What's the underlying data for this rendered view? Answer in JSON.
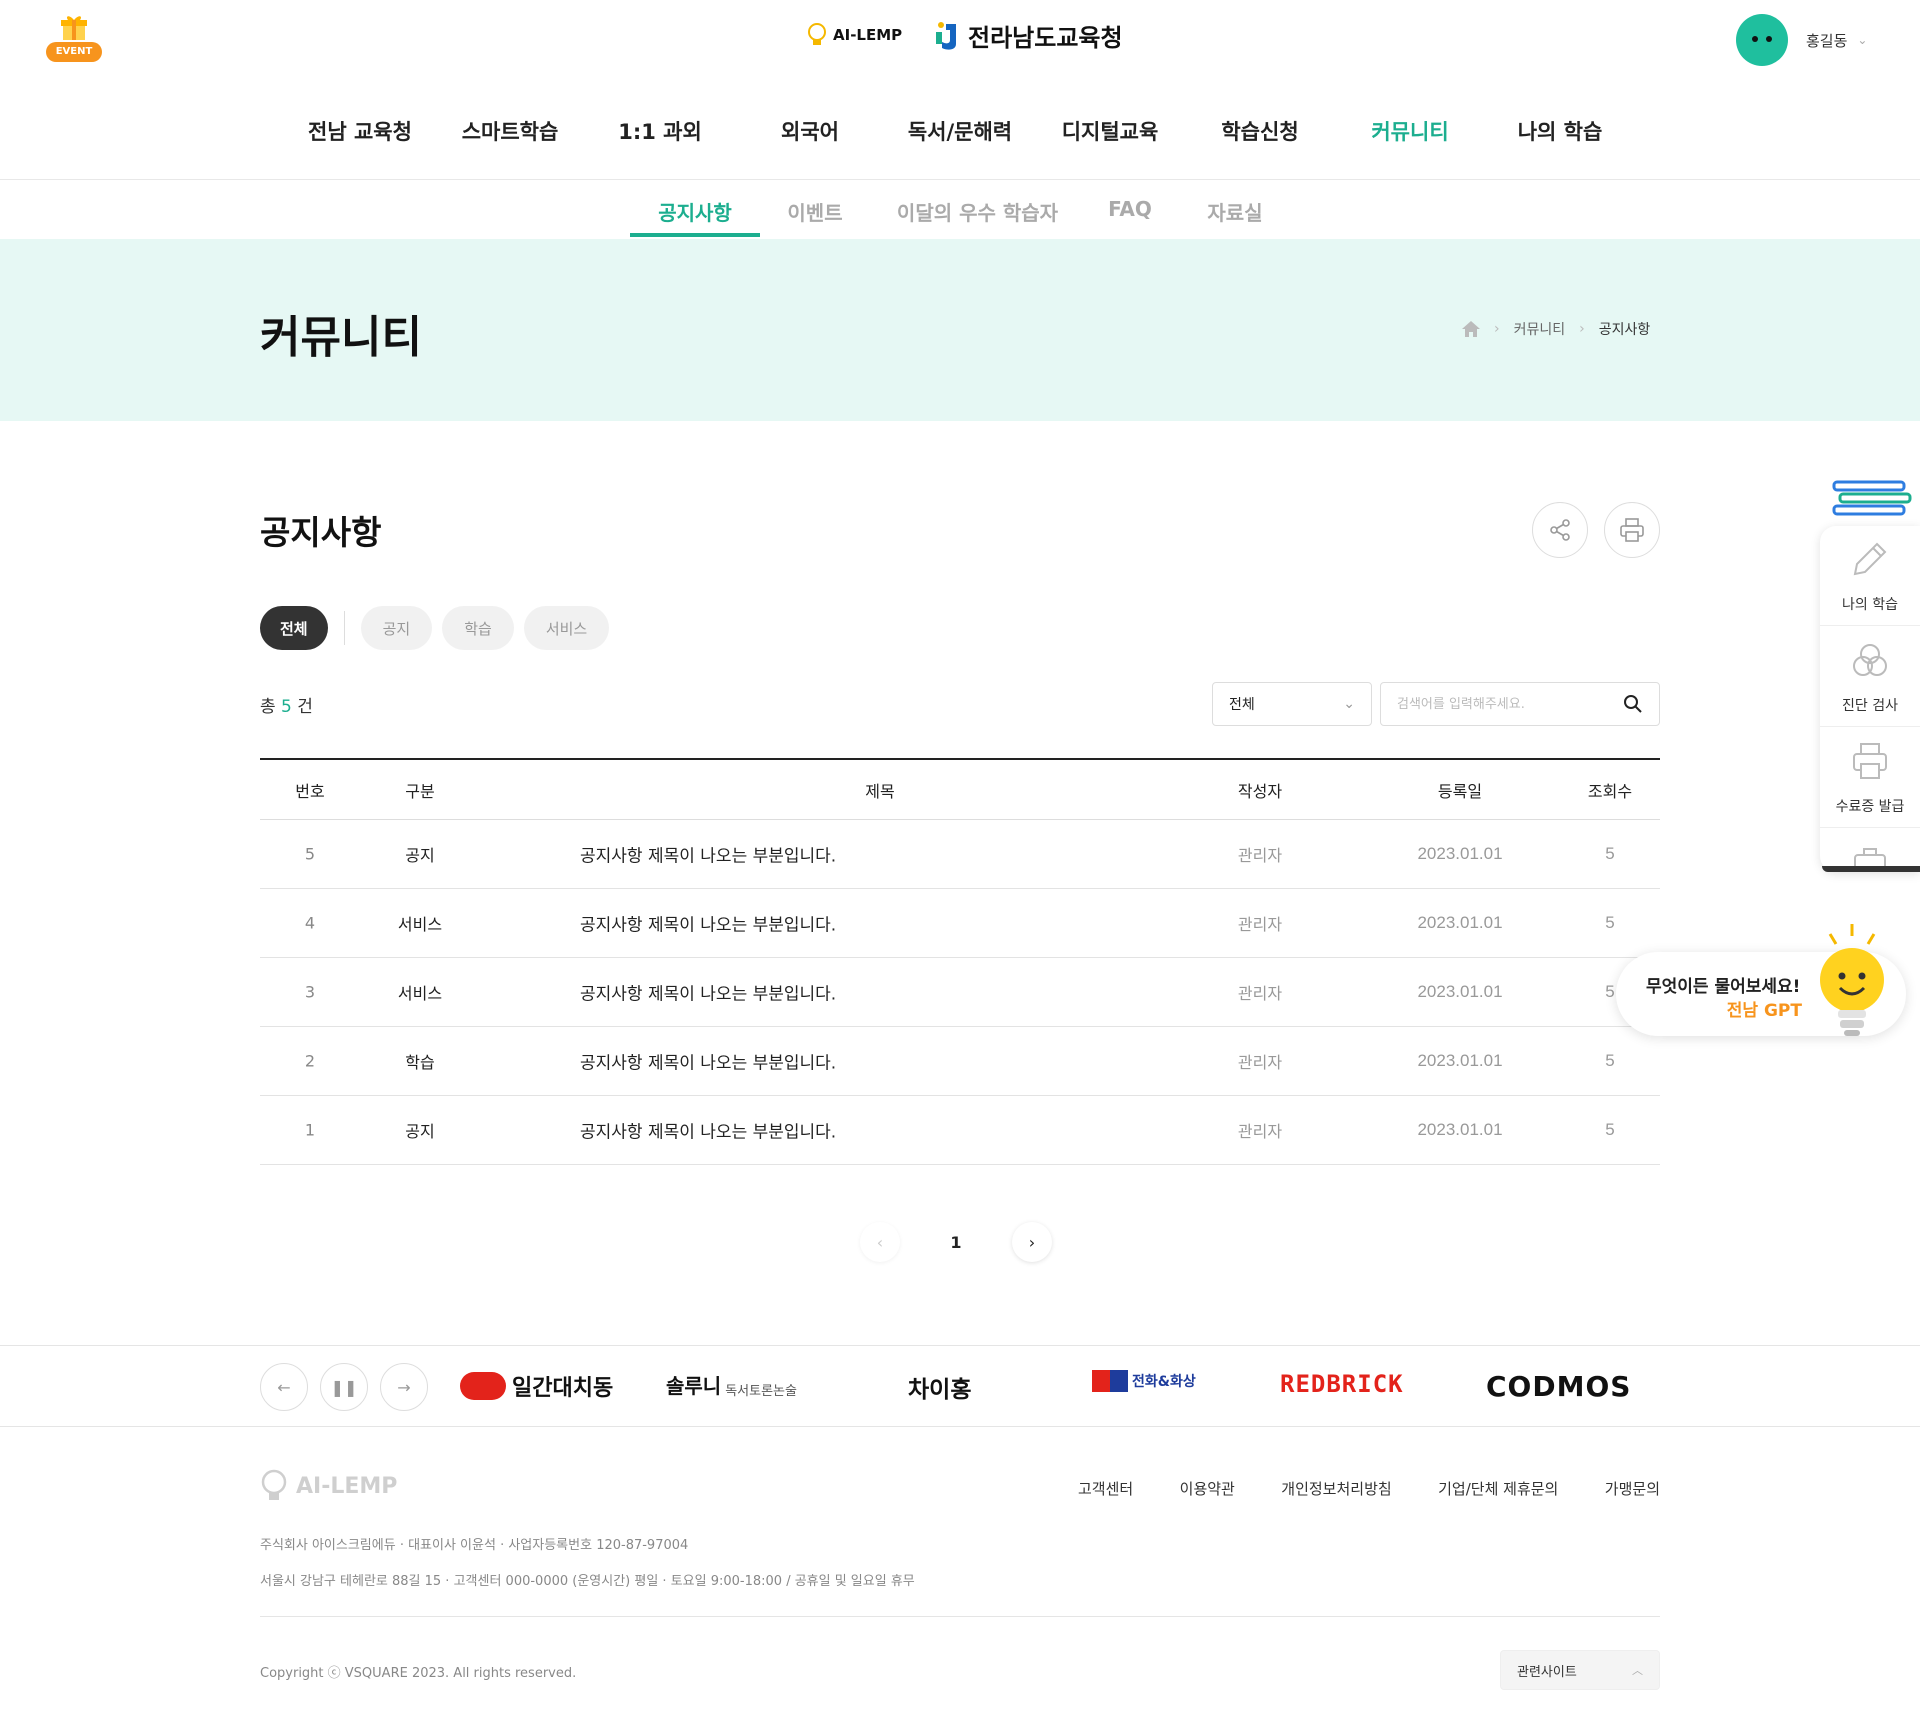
{
  "header": {
    "event_label": "EVENT",
    "logo_ai": "AI-LEMP",
    "logo_office": "전라남도교육청",
    "user_name": "홍길동"
  },
  "gnb": [
    "전남 교육청",
    "스마트학습",
    "1:1 과외",
    "외국어",
    "독서/문해력",
    "디지털교육",
    "학습신청",
    "커뮤니티",
    "나의 학습"
  ],
  "gnb_active": "커뮤니티",
  "lnb": [
    "공지사항",
    "이벤트",
    "이달의 우수 학습자",
    "FAQ",
    "자료실"
  ],
  "lnb_active": "공지사항",
  "hero": {
    "title": "커뮤니티",
    "breadcrumb": [
      "커뮤니티",
      "공지사항"
    ]
  },
  "board": {
    "title": "공지사항",
    "chips": [
      "전체",
      "공지",
      "학습",
      "서비스"
    ],
    "chip_active": "전체",
    "count_prefix": "총",
    "count_value": "5",
    "count_suffix": "건",
    "select_value": "전체",
    "search_placeholder": "검색어를 입력해주세요.",
    "columns": [
      "번호",
      "구분",
      "제목",
      "작성자",
      "등록일",
      "조회수"
    ],
    "rows": [
      {
        "no": "5",
        "cat": "공지",
        "title": "공지사항 제목이 나오는 부분입니다.",
        "author": "관리자",
        "date": "2023.01.01",
        "views": "5"
      },
      {
        "no": "4",
        "cat": "서비스",
        "title": "공지사항 제목이 나오는 부분입니다.",
        "author": "관리자",
        "date": "2023.01.01",
        "views": "5"
      },
      {
        "no": "3",
        "cat": "서비스",
        "title": "공지사항 제목이 나오는 부분입니다.",
        "author": "관리자",
        "date": "2023.01.01",
        "views": "5"
      },
      {
        "no": "2",
        "cat": "학습",
        "title": "공지사항 제목이 나오는 부분입니다.",
        "author": "관리자",
        "date": "2023.01.01",
        "views": "5"
      },
      {
        "no": "1",
        "cat": "공지",
        "title": "공지사항 제목이 나오는 부분입니다.",
        "author": "관리자",
        "date": "2023.01.01",
        "views": "5"
      }
    ],
    "current_page": "1"
  },
  "partners": [
    "일간대치동",
    "솔루니",
    "독서토론논술",
    "차이홍",
    "전화&화상",
    "REDBRICK",
    "CODMOS"
  ],
  "footer": {
    "logo": "AI-LEMP",
    "links": [
      "고객센터",
      "이용약관",
      "개인정보처리방침",
      "기업/단체 제휴문의",
      "가맹문의"
    ],
    "info_line1": "주식회사 아이스크림에듀 · 대표이사 이윤석 · 사업자등록번호 120-87-97004",
    "info_line2": "서울시 강남구 테헤란로 88길 15 · 고객센터 000-0000 (운영시간) 평일 · 토요일 9:00-18:00 / 공휴일 및 일요일 휴무",
    "copyright": "Copyright ⓒ VSQUARE 2023. All rights reserved.",
    "related_sites": "관련사이트"
  },
  "quick_menu": [
    "나의 학습",
    "진단 검사",
    "수료증 발급"
  ],
  "gpt": {
    "line1": "무엇이든 물어보세요!",
    "line2": "전남 GPT"
  },
  "colors": {
    "accent": "#1cae8f",
    "hero_bg": "#e6f8f4",
    "event_orange": "#f7941d"
  }
}
